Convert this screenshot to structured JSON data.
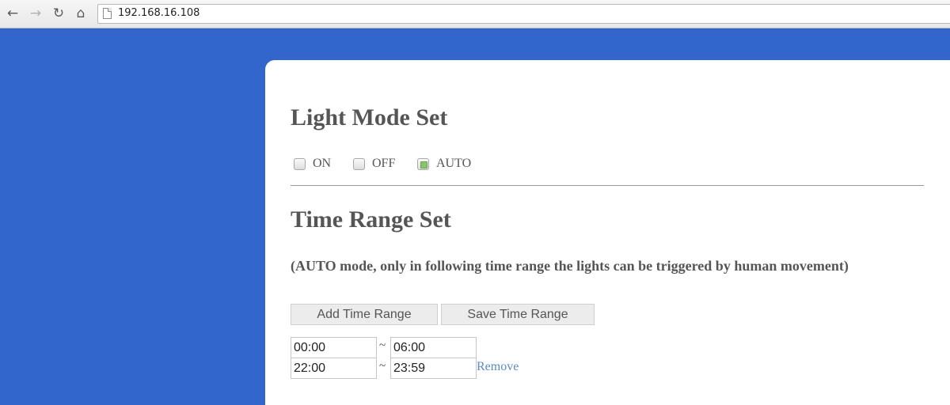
{
  "browser": {
    "url": "192.168.16.108",
    "icons": {
      "back": "arrow-left-icon",
      "forward": "arrow-right-icon",
      "reload": "reload-icon",
      "home": "home-icon",
      "page": "page-icon"
    }
  },
  "light_mode": {
    "title": "Light Mode Set",
    "options": [
      {
        "label": "ON",
        "checked": false
      },
      {
        "label": "OFF",
        "checked": false
      },
      {
        "label": "AUTO",
        "checked": true
      }
    ]
  },
  "time_range": {
    "title": "Time Range Set",
    "description": "(AUTO mode, only in following time range the lights can be triggered by human movement)",
    "add_button": "Add Time Range",
    "save_button": "Save Time Range",
    "separator": "~",
    "remove_label": "Remove",
    "ranges": [
      {
        "start": "00:00",
        "end": "06:00"
      },
      {
        "start": "22:00",
        "end": "23:59"
      }
    ]
  },
  "colors": {
    "page_background": "#3366cc",
    "checkbox_checked": "#8ac46a",
    "link": "#5b8bc4",
    "heading": "#555555"
  }
}
